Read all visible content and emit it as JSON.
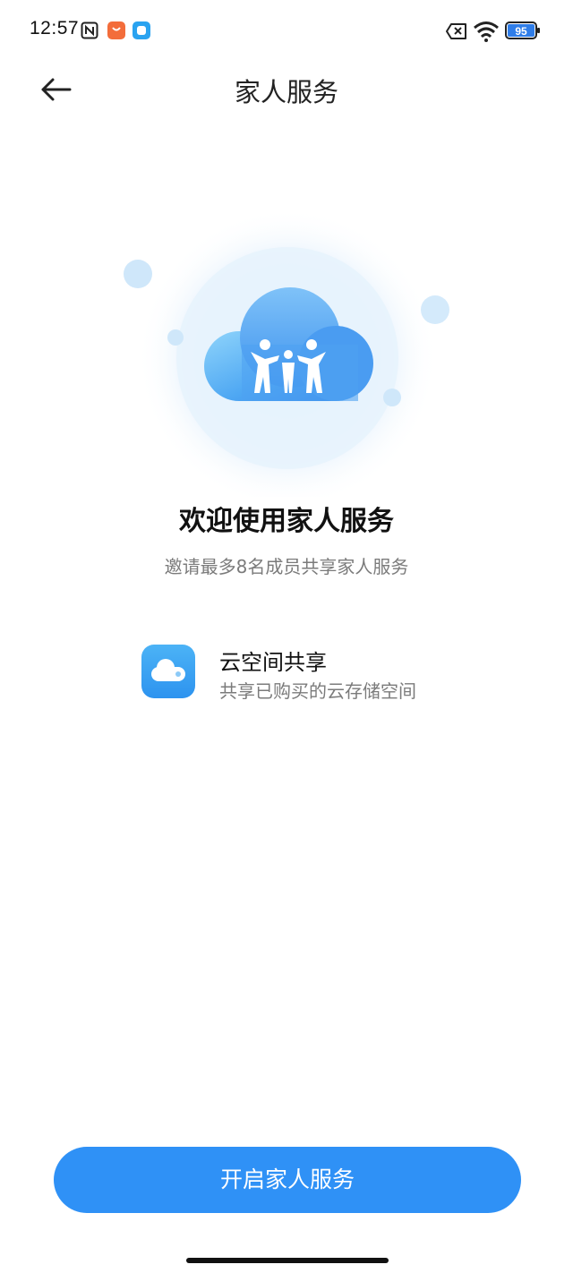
{
  "status_bar": {
    "time": "12:57",
    "battery": "95",
    "icons": [
      "nfc-icon",
      "mi-app-icon",
      "app-notification-icon",
      "no-sim-icon",
      "wifi-icon",
      "battery-icon"
    ]
  },
  "header": {
    "title": "家人服务",
    "back_icon": "arrow-left-icon"
  },
  "welcome": {
    "title": "欢迎使用家人服务",
    "subtitle": "邀请最多8名成员共享家人服务"
  },
  "features": [
    {
      "icon": "cloud-icon",
      "title": "云空间共享",
      "description": "共享已购买的云存储空间"
    }
  ],
  "primary_button": {
    "label": "开启家人服务"
  },
  "colors": {
    "accent": "#2f91f6",
    "feature_icon_bg": "#3aa7f3",
    "secondary_text": "#7b7b7b"
  }
}
